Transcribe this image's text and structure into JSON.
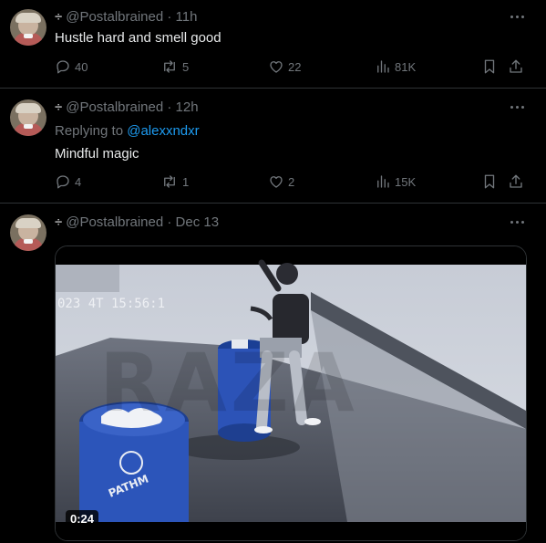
{
  "tweets": [
    {
      "separator": "÷",
      "handle": "@Postalbrained",
      "time": "· 11h",
      "text": "Hustle hard and smell good",
      "reply_count": "40",
      "repost_count": "5",
      "like_count": "22",
      "view_count": "81K"
    },
    {
      "separator": "÷",
      "handle": "@Postalbrained",
      "time": "· 12h",
      "replying_label": "Replying to",
      "replying_handle": "@alexxndxr",
      "text": "Mindful magic",
      "reply_count": "4",
      "repost_count": "1",
      "like_count": "2",
      "view_count": "15K"
    },
    {
      "separator": "÷",
      "handle": "@Postalbrained",
      "time": "· Dec 13",
      "media": {
        "timestamp": "023 4T 15:56:1",
        "watermark": "RAZA",
        "barrel_logo": "PATHM",
        "duration": "0:24"
      }
    }
  ],
  "colors": {
    "background": "#000000",
    "text": "#e7e9ea",
    "muted": "#71767b",
    "link": "#1d9bf0",
    "divider": "#2f3336"
  },
  "icons": [
    "reply-icon",
    "repost-icon",
    "like-icon",
    "views-icon",
    "bookmark-icon",
    "share-icon",
    "more-icon"
  ]
}
